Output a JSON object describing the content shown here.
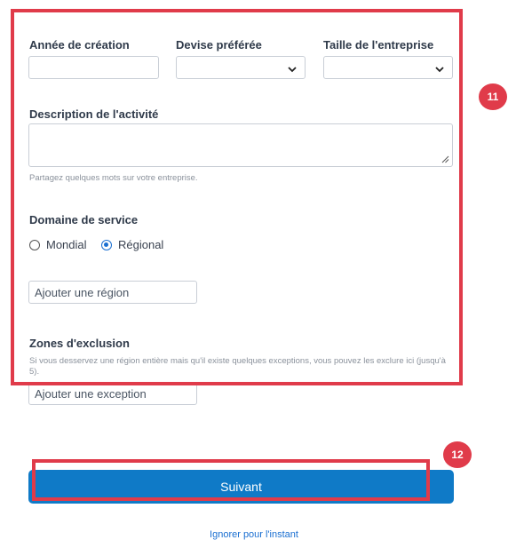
{
  "form": {
    "year_label": "Année de création",
    "currency_label": "Devise préférée",
    "size_label": "Taille de l'entreprise",
    "description_label": "Description de l'activité",
    "description_hint": "Partagez quelques mots sur votre entreprise.",
    "service_domain_label": "Domaine de service",
    "radio_global": "Mondial",
    "radio_regional": "Régional",
    "selected_scope": "Régional",
    "region_placeholder": "Ajouter une région",
    "exclusion_label": "Zones d'exclusion",
    "exclusion_hint": "Si vous desservez une région entière mais qu'il existe quelques exceptions, vous pouvez les exclure ici (jusqu'à 5).",
    "exception_placeholder": "Ajouter une exception"
  },
  "actions": {
    "next_label": "Suivant",
    "skip_label": "Ignorer pour l'instant"
  },
  "annotations": {
    "badge_11": "11",
    "badge_12": "12",
    "highlight_color": "#e03b4a"
  },
  "colors": {
    "primary_button": "#0f7ac7",
    "link": "#1a6fd1"
  }
}
